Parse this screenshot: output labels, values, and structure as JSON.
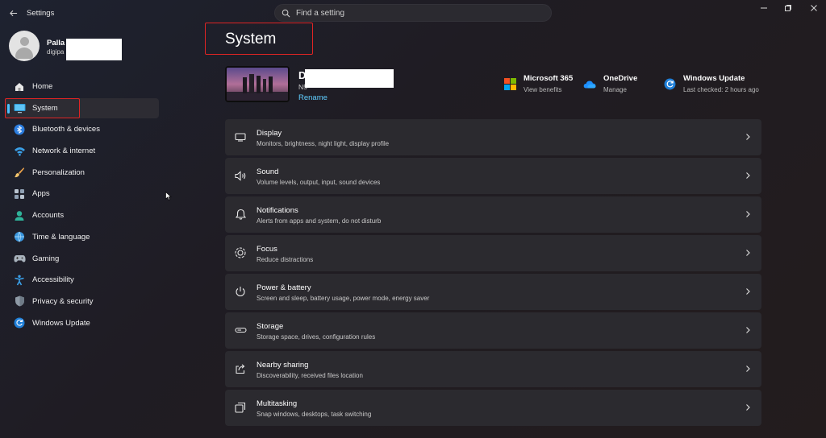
{
  "app": {
    "title": "Settings"
  },
  "search": {
    "placeholder": "Find a setting"
  },
  "profile": {
    "name": "Palla",
    "email": "digipa"
  },
  "nav": {
    "items": [
      {
        "label": "Home",
        "icon": "home-icon"
      },
      {
        "label": "System",
        "icon": "monitor-icon"
      },
      {
        "label": "Bluetooth & devices",
        "icon": "bluetooth-icon"
      },
      {
        "label": "Network & internet",
        "icon": "wifi-icon"
      },
      {
        "label": "Personalization",
        "icon": "brush-icon"
      },
      {
        "label": "Apps",
        "icon": "apps-icon"
      },
      {
        "label": "Accounts",
        "icon": "person-icon"
      },
      {
        "label": "Time & language",
        "icon": "globe-clock-icon"
      },
      {
        "label": "Gaming",
        "icon": "gamepad-icon"
      },
      {
        "label": "Accessibility",
        "icon": "accessibility-icon"
      },
      {
        "label": "Privacy & security",
        "icon": "shield-icon"
      },
      {
        "label": "Windows Update",
        "icon": "update-icon"
      }
    ],
    "active": "System"
  },
  "page": {
    "title": "System"
  },
  "device": {
    "name": "D",
    "model": "N5",
    "rename": "Rename"
  },
  "quick_links": [
    {
      "title": "Microsoft 365",
      "subtitle": "View benefits",
      "icon": "microsoft-365-icon"
    },
    {
      "title": "OneDrive",
      "subtitle": "Manage",
      "icon": "onedrive-icon"
    },
    {
      "title": "Windows Update",
      "subtitle": "Last checked: 2 hours ago",
      "icon": "windows-update-icon"
    }
  ],
  "settings": [
    {
      "title": "Display",
      "subtitle": "Monitors, brightness, night light, display profile",
      "icon": "display-icon"
    },
    {
      "title": "Sound",
      "subtitle": "Volume levels, output, input, sound devices",
      "icon": "speaker-icon"
    },
    {
      "title": "Notifications",
      "subtitle": "Alerts from apps and system, do not disturb",
      "icon": "bell-icon"
    },
    {
      "title": "Focus",
      "subtitle": "Reduce distractions",
      "icon": "focus-icon"
    },
    {
      "title": "Power & battery",
      "subtitle": "Screen and sleep, battery usage, power mode, energy saver",
      "icon": "power-icon"
    },
    {
      "title": "Storage",
      "subtitle": "Storage space, drives, configuration rules",
      "icon": "storage-icon"
    },
    {
      "title": "Nearby sharing",
      "subtitle": "Discoverability, received files location",
      "icon": "share-icon"
    },
    {
      "title": "Multitasking",
      "subtitle": "Snap windows, desktops, task switching",
      "icon": "multitasking-icon"
    }
  ],
  "colors": {
    "accent": "#4cc2ff",
    "link": "#60cdff",
    "highlight": "#e02424",
    "card": "#2b2a2f"
  }
}
